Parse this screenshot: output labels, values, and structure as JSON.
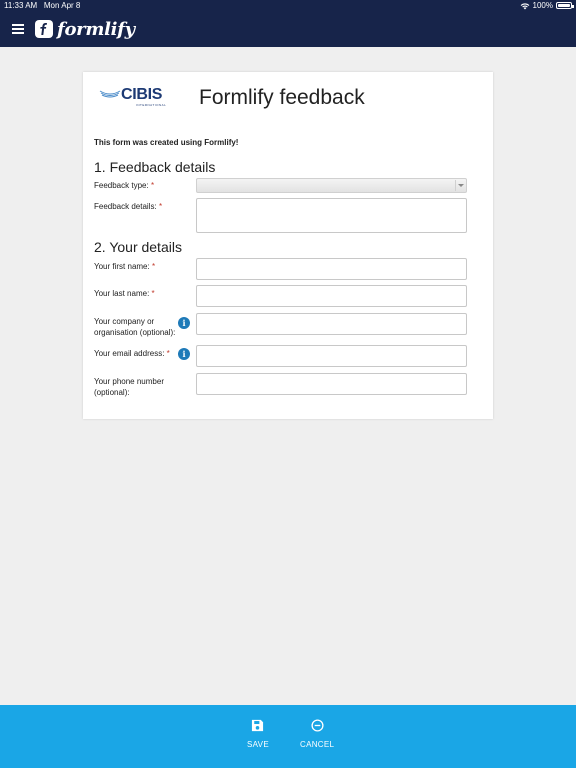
{
  "status_bar": {
    "time": "11:33 AM",
    "date": "Mon Apr 8",
    "battery": "100%"
  },
  "app": {
    "name": "formlify"
  },
  "form": {
    "logo_text": "CIBIS",
    "logo_subtext": "INTERNATIONAL",
    "title": "Formlify feedback",
    "intro": "This form was created using Formlify!",
    "section1_title": "1. Feedback details",
    "section2_title": "2. Your details",
    "required_marker": "*",
    "info_glyph": "i",
    "fields": {
      "feedback_type": {
        "label": "Feedback type:",
        "value": ""
      },
      "feedback_details": {
        "label": "Feedback details:",
        "value": ""
      },
      "first_name": {
        "label": "Your first name:",
        "value": ""
      },
      "last_name": {
        "label": "Your last name:",
        "value": ""
      },
      "company_line1": "Your company or",
      "company_line2": "organisation (optional):",
      "email": {
        "label": "Your email address:",
        "value": ""
      },
      "phone_line1": "Your phone number",
      "phone_line2": "(optional):"
    }
  },
  "toolbar": {
    "save_label": "SAVE",
    "cancel_label": "CANCEL"
  },
  "colors": {
    "header_bg": "#17244a",
    "toolbar_bg": "#1aa6e6",
    "info_icon": "#1e7ab8",
    "required": "#c0392b",
    "page_bg": "#efefef"
  }
}
